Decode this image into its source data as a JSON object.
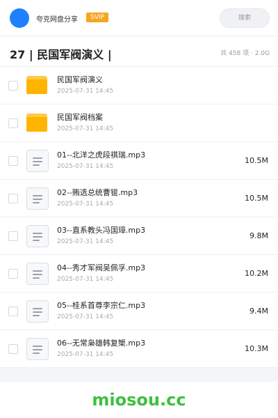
{
  "header": {
    "app_name": "夸克网盘分享",
    "badge": "SVIP",
    "search_placeholder": "搜索"
  },
  "folder": {
    "title": "27 | 民国军阀演义 |",
    "summary": "共 458 项 · 2.0G"
  },
  "items": [
    {
      "type": "folder",
      "icon": "folder-icon",
      "name": "民国军阀演义",
      "date": "2025-07-31 14:45",
      "size": ""
    },
    {
      "type": "folder",
      "icon": "folder-icon",
      "name": "民国军阀档案",
      "date": "2025-07-31 14:45",
      "size": ""
    },
    {
      "type": "file",
      "icon": "audio-file-icon",
      "name": "01--北洋之虎段祺瑞.mp3",
      "date": "2025-07-31 14:45",
      "size": "10.5M"
    },
    {
      "type": "file",
      "icon": "audio-file-icon",
      "name": "02--贿选总统曹锟.mp3",
      "date": "2025-07-31 14:45",
      "size": "10.5M"
    },
    {
      "type": "file",
      "icon": "audio-file-icon",
      "name": "03--直系教头冯国璋.mp3",
      "date": "2025-07-31 14:45",
      "size": "9.8M"
    },
    {
      "type": "file",
      "icon": "audio-file-icon",
      "name": "04--秀才军阀吴佩孚.mp3",
      "date": "2025-07-31 14:45",
      "size": "10.2M"
    },
    {
      "type": "file",
      "icon": "audio-file-icon",
      "name": "05--桂系首尊李宗仁.mp3",
      "date": "2025-07-31 14:45",
      "size": "9.4M"
    },
    {
      "type": "file",
      "icon": "audio-file-icon",
      "name": "06--无常枭雄韩复榘.mp3",
      "date": "2025-07-31 14:45",
      "size": "10.3M"
    }
  ],
  "watermark": "miosou.cc",
  "colors": {
    "avatar": "#1e80ff",
    "badge": "#f5a623",
    "folder": "#ffb400",
    "watermark": "#3fbf3f"
  }
}
